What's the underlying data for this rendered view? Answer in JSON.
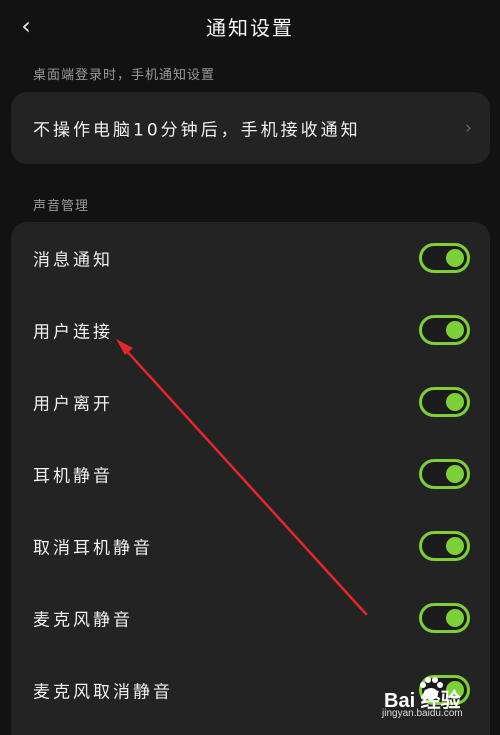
{
  "header": {
    "back_icon": "chevron-left-icon",
    "title": "通知设置"
  },
  "desktop_section": {
    "label": "桌面端登录时，手机通知设置",
    "item": {
      "label": "不操作电脑10分钟后，手机接收通知",
      "icon": "chevron-right-icon"
    }
  },
  "sound_section": {
    "label": "声音管理",
    "items": [
      {
        "label": "消息通知",
        "on": true
      },
      {
        "label": "用户连接",
        "on": true
      },
      {
        "label": "用户离开",
        "on": true
      },
      {
        "label": "耳机静音",
        "on": true
      },
      {
        "label": "取消耳机静音",
        "on": true
      },
      {
        "label": "麦克风静音",
        "on": true
      },
      {
        "label": "麦克风取消静音",
        "on": true
      }
    ]
  },
  "colors": {
    "background": "#121212",
    "card": "#232323",
    "toggle_accent": "#7ed03a",
    "annotation_arrow": "#e0282a"
  },
  "watermark": {
    "brand": "Bai  经验",
    "url": "jingyan.baidu.com"
  }
}
